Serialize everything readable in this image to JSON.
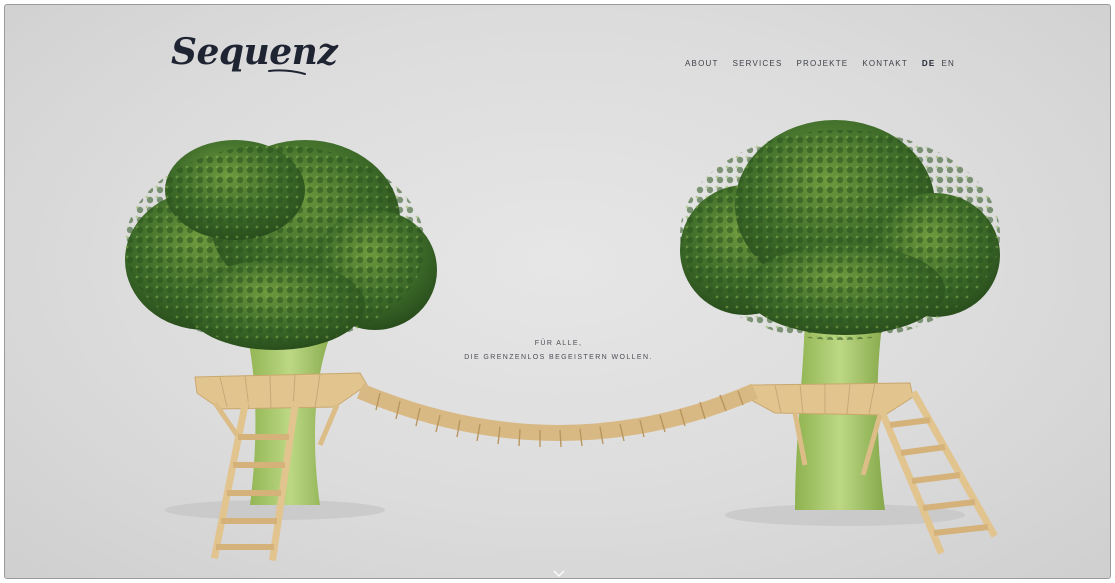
{
  "brand": {
    "logo_text": "Sequenz"
  },
  "nav": {
    "items": [
      {
        "label": "ABOUT"
      },
      {
        "label": "SERVICES"
      },
      {
        "label": "PROJEKTE"
      },
      {
        "label": "KONTAKT"
      }
    ],
    "languages": [
      {
        "label": "DE",
        "active": true
      },
      {
        "label": "EN",
        "active": false
      }
    ]
  },
  "hero": {
    "line1": "FÜR ALLE,",
    "line2": "DIE GRENZENLOS BEGEISTERN WOLLEN.",
    "image": "broccoli-treehouse-illustration"
  },
  "scroll": {
    "icon": "chevron-down-icon"
  },
  "colors": {
    "background": "#dcdcdc",
    "logo": "#1f2433",
    "nav_text": "#3e414a",
    "broccoli_dark": "#2e5a22",
    "broccoli_light": "#6f9a3e",
    "stem": "#a9c86a",
    "wood": "#e2c48f"
  }
}
